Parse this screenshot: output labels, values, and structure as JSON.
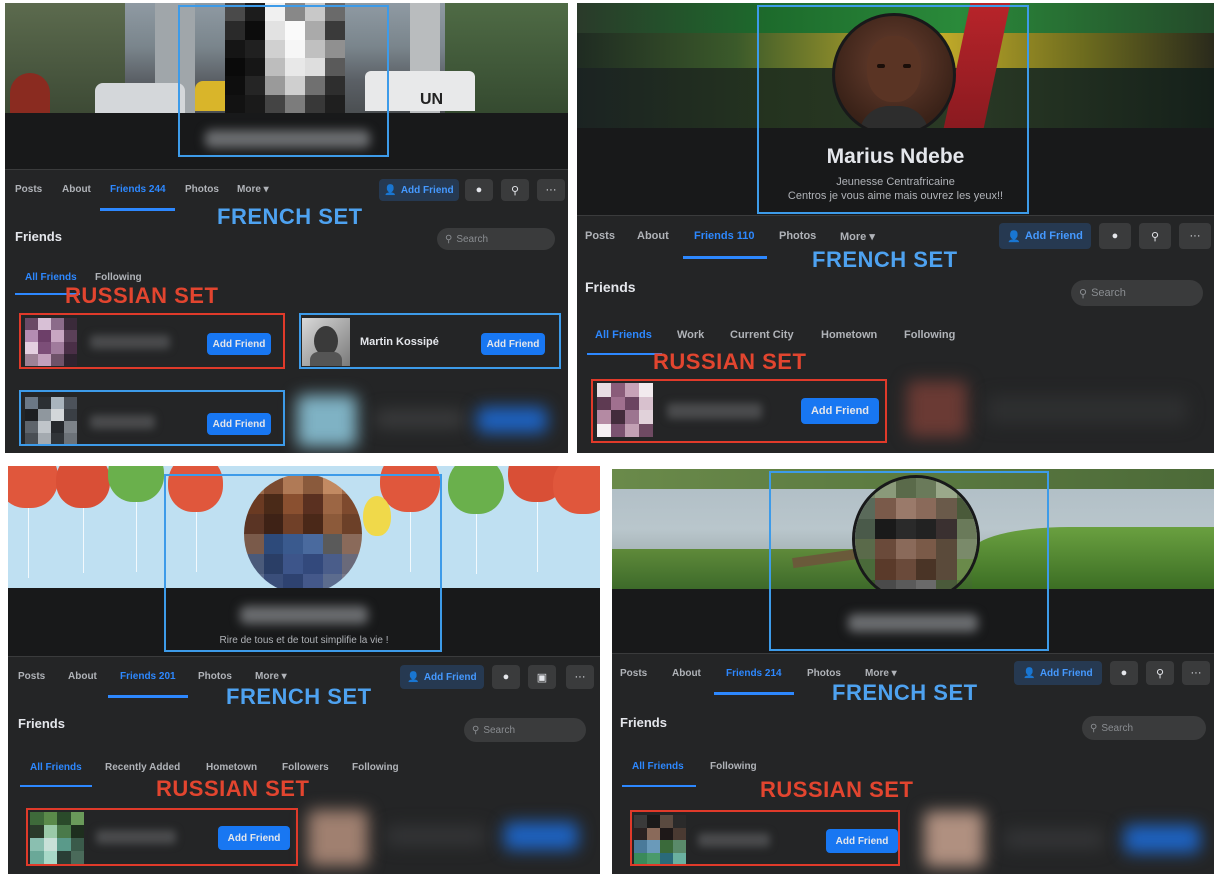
{
  "panels": [
    {
      "id": "top-left",
      "nav": {
        "posts": "Posts",
        "about": "About",
        "friends": "Friends 244",
        "photos": "Photos",
        "more": "More ▾"
      },
      "add_friend": "Add Friend",
      "friends_title": "Friends",
      "search_placeholder": "Search",
      "tabs": [
        "All Friends",
        "Following"
      ],
      "friend_named": "Martin Kossipé",
      "card_add_friend": "Add Friend",
      "label_french": "FRENCH SET",
      "label_russian": "RUSSIAN SET"
    },
    {
      "id": "top-right",
      "profile_name": "Marius Ndebe",
      "profile_line1": "Jeunesse Centrafricaine",
      "profile_line2": "Centros je vous aime mais ouvrez les yeux!!",
      "nav": {
        "posts": "Posts",
        "about": "About",
        "friends": "Friends 110",
        "photos": "Photos",
        "more": "More ▾"
      },
      "add_friend": "Add Friend",
      "friends_title": "Friends",
      "search_placeholder": "Search",
      "tabs": [
        "All Friends",
        "Work",
        "Current City",
        "Hometown",
        "Following"
      ],
      "card_add_friend": "Add Friend",
      "label_french": "FRENCH SET",
      "label_russian": "RUSSIAN SET"
    },
    {
      "id": "bottom-left",
      "profile_line1": "Rire de tous et de tout simplifie la vie !",
      "nav": {
        "posts": "Posts",
        "about": "About",
        "friends": "Friends 201",
        "photos": "Photos",
        "more": "More ▾"
      },
      "add_friend": "Add Friend",
      "friends_title": "Friends",
      "search_placeholder": "Search",
      "tabs": [
        "All Friends",
        "Recently Added",
        "Hometown",
        "Followers",
        "Following"
      ],
      "card_add_friend": "Add Friend",
      "label_french": "FRENCH SET",
      "label_russian": "RUSSIAN SET"
    },
    {
      "id": "bottom-right",
      "nav": {
        "posts": "Posts",
        "about": "About",
        "friends": "Friends 214",
        "photos": "Photos",
        "more": "More ▾"
      },
      "add_friend": "Add Friend",
      "friends_title": "Friends",
      "search_placeholder": "Search",
      "tabs": [
        "All Friends",
        "Following"
      ],
      "card_add_friend": "Add Friend",
      "label_french": "FRENCH SET",
      "label_russian": "RUSSIAN SET"
    }
  ],
  "icons": {
    "add_friend": "person-plus-icon",
    "messenger": "messenger-icon",
    "search": "search-icon",
    "more": "ellipsis-icon",
    "camera": "camera-icon"
  },
  "colors": {
    "facebook_blue": "#1877f2",
    "annotation_blue": "#3d9be9",
    "annotation_red": "#e03a2a",
    "dark_bg": "#242526"
  }
}
